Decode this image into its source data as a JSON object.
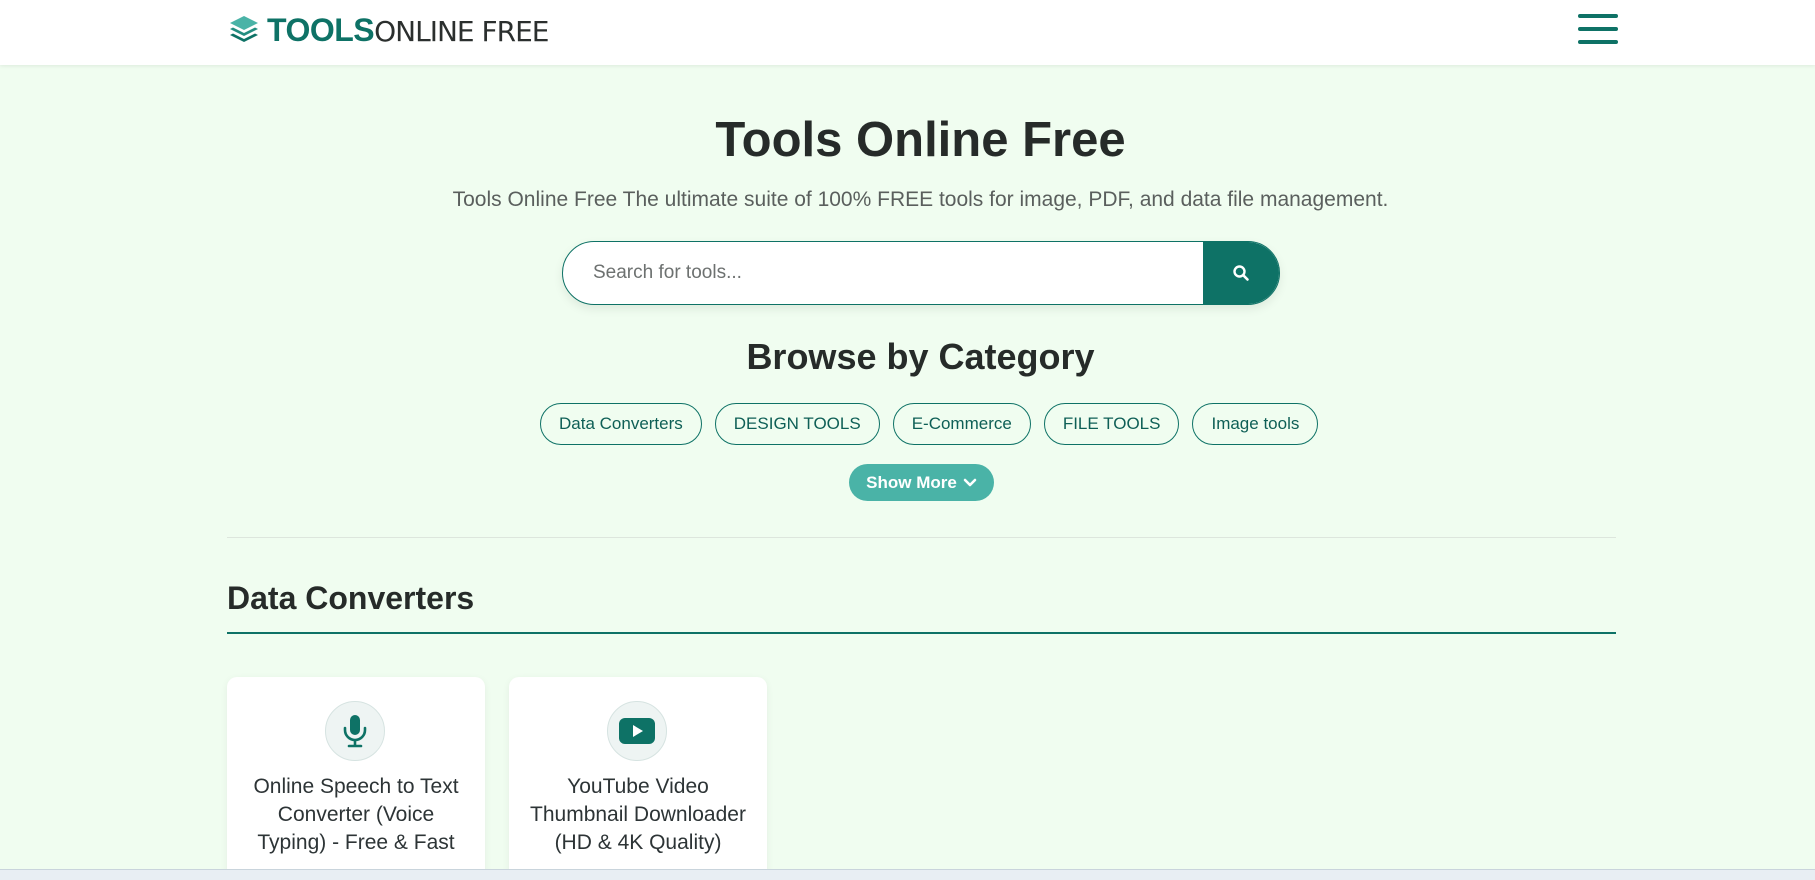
{
  "header": {
    "logo_bold": "TOOLS",
    "logo_light": "ONLINE FREE",
    "menu_icon": "hamburger-menu-icon"
  },
  "hero": {
    "title": "Tools Online Free",
    "subtitle": "Tools Online Free The ultimate suite of 100% FREE tools for image, PDF, and data file management."
  },
  "search": {
    "placeholder": "Search for tools...",
    "value": "",
    "icon": "search-icon"
  },
  "browse": {
    "title": "Browse by Category",
    "categories": [
      "Data Converters",
      "DESIGN TOOLS",
      "E-Commerce",
      "FILE TOOLS",
      "Image tools"
    ],
    "show_more": "Show More"
  },
  "section": {
    "title": "Data Converters",
    "cards": [
      {
        "title": "Online Speech to Text Converter (Voice Typing) - Free & Fast",
        "icon": "microphone-icon"
      },
      {
        "title": "YouTube Video Thumbnail Downloader (HD & 4K Quality)",
        "icon": "youtube-icon"
      }
    ]
  },
  "colors": {
    "brand": "#0e7266",
    "accent": "#4ab3a7",
    "background": "#f0fdf0"
  }
}
